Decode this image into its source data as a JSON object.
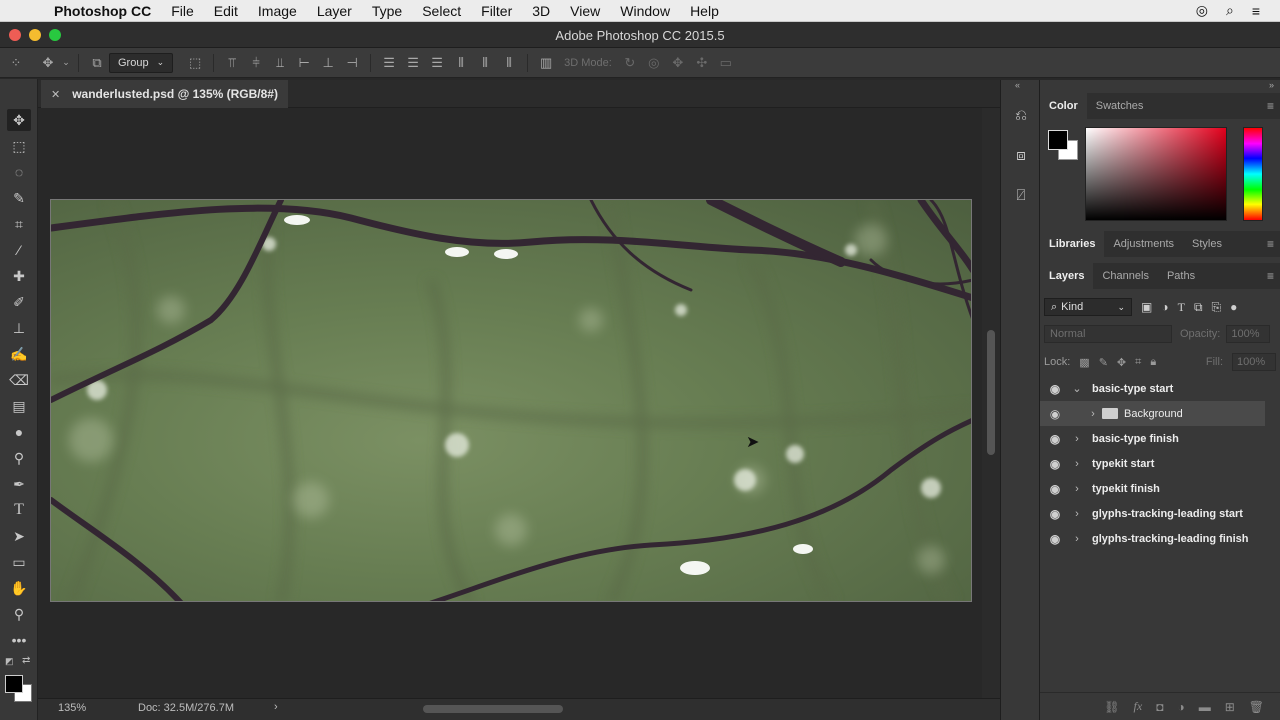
{
  "menubar": {
    "app_name": "Photoshop CC",
    "items": [
      "File",
      "Edit",
      "Image",
      "Layer",
      "Type",
      "Select",
      "Filter",
      "3D",
      "View",
      "Window",
      "Help"
    ]
  },
  "window": {
    "title": "Adobe Photoshop CC 2015.5"
  },
  "options_bar": {
    "auto_select_value": "Group",
    "mode_3d_label": "3D Mode:"
  },
  "document": {
    "tab_label": "wanderlusted.psd @ 135% (RGB/8#)"
  },
  "status": {
    "zoom": "135%",
    "doc_size": "Doc: 32.5M/276.7M"
  },
  "color_panel": {
    "tabs": [
      "Color",
      "Swatches"
    ],
    "foreground": "#000000",
    "background": "#ffffff"
  },
  "libraries_panel": {
    "tabs": [
      "Libraries",
      "Adjustments",
      "Styles"
    ]
  },
  "layers_panel": {
    "tabs": [
      "Layers",
      "Channels",
      "Paths"
    ],
    "filter_kind": "Kind",
    "blend_mode": "Normal",
    "opacity_label": "Opacity:",
    "opacity_value": "100%",
    "lock_label": "Lock:",
    "fill_label": "Fill:",
    "fill_value": "100%",
    "layers": [
      {
        "name": "basic-type start",
        "expanded": true,
        "indent": false
      },
      {
        "name": "Background",
        "expanded": false,
        "indent": true,
        "folder": true
      },
      {
        "name": "basic-type finish",
        "expanded": false,
        "indent": false
      },
      {
        "name": "typekit start",
        "expanded": false,
        "indent": false
      },
      {
        "name": "typekit finish",
        "expanded": false,
        "indent": false
      },
      {
        "name": "glyphs-tracking-leading start",
        "expanded": false,
        "indent": false
      },
      {
        "name": "glyphs-tracking-leading finish",
        "expanded": false,
        "indent": false
      }
    ]
  },
  "colors": {
    "accent_red": "#ee5d55",
    "accent_yellow": "#f5bc2f",
    "accent_green": "#28c840"
  }
}
